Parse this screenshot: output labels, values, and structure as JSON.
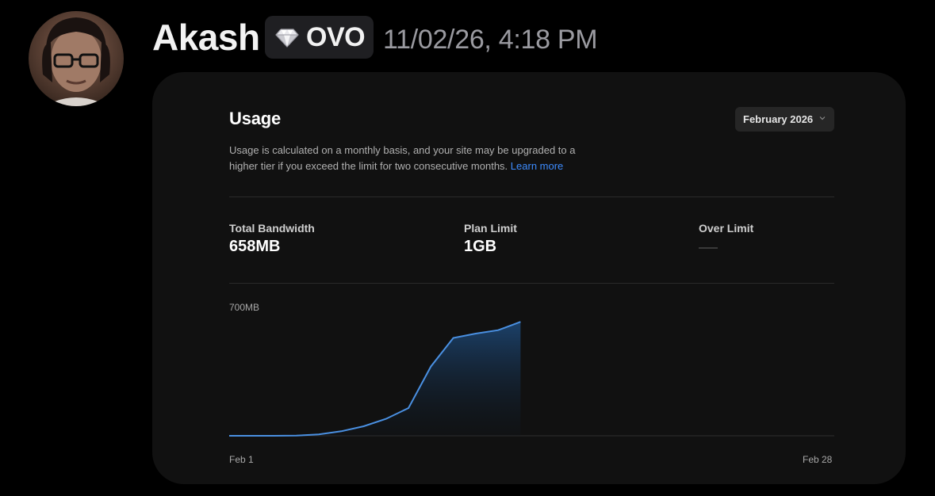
{
  "message": {
    "author": "Akash",
    "tag": {
      "text": "OVO",
      "icon": "gem-icon"
    },
    "timestamp": "11/02/26, 4:18 PM"
  },
  "usage": {
    "title": "Usage",
    "month_select": {
      "value": "February 2026",
      "icon": "chevron-down-icon"
    },
    "description": "Usage is calculated on a monthly basis, and your site may be upgraded to a higher tier if you exceed the limit for two consecutive months.",
    "learn_more": "Learn more",
    "stats": {
      "total_bandwidth": {
        "label": "Total Bandwidth",
        "value": "658MB"
      },
      "plan_limit": {
        "label": "Plan Limit",
        "value": "1GB"
      },
      "over_limit": {
        "label": "Over Limit",
        "value": ""
      }
    }
  },
  "colors": {
    "accent": "#3d8bfd",
    "line": "#4a90e2",
    "card_bg": "#111111",
    "page_bg": "#000000"
  },
  "chart_data": {
    "type": "area",
    "xlabel_start": "Feb 1",
    "xlabel_end": "Feb 28",
    "ytick_label": "700MB",
    "ylim": [
      0,
      700
    ],
    "x": [
      1,
      2,
      3,
      4,
      5,
      6,
      7,
      8,
      9,
      10,
      11,
      12,
      13,
      14,
      15,
      28
    ],
    "values": [
      0,
      0,
      0,
      1,
      8,
      26,
      55,
      98,
      160,
      400,
      565,
      590,
      610,
      658,
      null,
      null
    ],
    "x_day_labels_only": true,
    "grid": false
  }
}
